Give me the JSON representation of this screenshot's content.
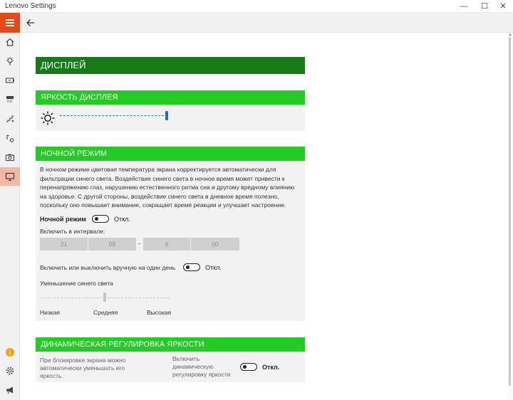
{
  "window": {
    "title": "Lenovo Settings",
    "minimize": "—",
    "maximize": "☐",
    "close": "✕"
  },
  "nav": {
    "items": [
      "home-icon",
      "bulb-icon",
      "battery-icon",
      "wifi-icon",
      "network-icon",
      "audio-icon",
      "camera-icon",
      "display-icon"
    ],
    "bottom_items": [
      "info-icon",
      "gear-icon",
      "megaphone-icon"
    ],
    "accent": "#e24a1b",
    "active_bg": "#f2b8a5"
  },
  "page": {
    "title": "ДИСПЛЕЙ"
  },
  "brightness": {
    "title": "ЯРКОСТЬ ДИСПЛЕЯ",
    "level": 1.0
  },
  "night": {
    "title": "НОЧНОЙ РЕЖИМ",
    "description": "В ночном режиме цветовая температура экрана корректируется автоматически для фильтрации синего света. Воздействие синего света в ночное время может привести к перенапряжению глаз, нарушению естественного ритма сна и другому вредному влиянию на здоровье. С другой стороны, воздействие синего света в дневное время полезно, поскольку оно повышает внимание, сокращает время реакции и улучшает настроение.",
    "mode_label": "Ночной режим",
    "mode_state": "Откл.",
    "interval_label": "Включить в интервале:",
    "start_hour": "21",
    "start_min": "00",
    "separator": "-",
    "end_hour": "6",
    "end_min": "00",
    "manual_label": "Включить или выключить вручную на один день",
    "manual_state": "Откл.",
    "blue_label": "Уменьшение синего света",
    "blue_low": "Низкая",
    "blue_mid": "Средняя",
    "blue_high": "Высокая",
    "blue_level": 0.5
  },
  "dynamic": {
    "title": "ДИНАМИЧЕСКАЯ РЕГУЛИРОВКА ЯРКОСТИ",
    "description": "При блокировке экрана можно автоматически уменьшать его яркость.",
    "enable_label": "Включить динамическую регулировку яркости",
    "state": "Откл."
  },
  "colors": {
    "header_dark_green": "#177a17",
    "section_green": "#22cc22",
    "slider_blue": "#1f6fd1"
  }
}
